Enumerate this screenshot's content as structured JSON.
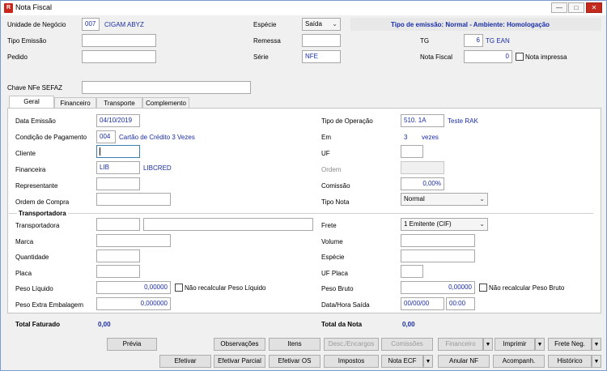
{
  "window": {
    "title": "Nota Fiscal",
    "icon_letter": "R",
    "icons": [
      "app-icon",
      "minimize-icon",
      "restore-icon",
      "close-icon"
    ],
    "controls": {
      "minimize": "—",
      "restore": "□",
      "close": "✕"
    }
  },
  "header": {
    "unidade_label": "Unidade de Negócio",
    "unidade_code": "007",
    "unidade_name": "CIGAM ABYZ",
    "especie_label": "Espécie",
    "especie_value": "Saída",
    "tipo_emissao_info": "Tipo de emissão: Normal - Ambiente: Homologação",
    "tipo_emissao_label": "Tipo Emissão",
    "tipo_emissao_value": "",
    "remessa_label": "Remessa",
    "remessa_value": "",
    "tg_label": "TG",
    "tg_value": "6",
    "tg_name": "TG EAN",
    "pedido_label": "Pedido",
    "pedido_value": "",
    "serie_label": "Série",
    "serie_value": "NFE",
    "nota_fiscal_label": "Nota Fiscal",
    "nota_fiscal_value": "0",
    "nota_impressa_label": "Nota impressa",
    "chave_label": "Chave NFe SEFAZ",
    "chave_value": ""
  },
  "tabs": [
    {
      "label": "Geral",
      "active": true
    },
    {
      "label": "Financeiro",
      "active": false
    },
    {
      "label": "Transporte",
      "active": false
    },
    {
      "label": "Complemento",
      "active": false
    }
  ],
  "geral": {
    "data_emissao_label": "Data Emissão",
    "data_emissao_value": "04/10/2019",
    "tipo_operacao_label": "Tipo de Operação",
    "tipo_operacao_code": "510. 1A",
    "tipo_operacao_name": "Teste RAK",
    "cond_pag_label": "Condição de Pagamento",
    "cond_pag_code": "004",
    "cond_pag_name": "Cartão de Crédito 3 Vezes",
    "em_label": "Em",
    "em_value": "3",
    "em_unit": "vezes",
    "cliente_label": "Cliente",
    "cliente_value": "",
    "uf_label": "UF",
    "uf_value": "",
    "financeira_label": "Financeira",
    "financeira_code": "LIB",
    "financeira_name": "LIBCRED",
    "ordem_label": "Ordem",
    "ordem_value": "",
    "representante_label": "Representante",
    "representante_value": "",
    "comissao_label": "Comissão",
    "comissao_value": "0,00%",
    "ordem_compra_label": "Ordem de Compra",
    "ordem_compra_value": "",
    "tipo_nota_label": "Tipo Nota",
    "tipo_nota_value": "Normal"
  },
  "transportadora": {
    "group_label": "Transportadora",
    "transportadora_label": "Transportadora",
    "transportadora_code": "",
    "transportadora_name": "",
    "frete_label": "Frete",
    "frete_value": "1 Emitente (CIF)",
    "marca_label": "Marca",
    "marca_value": "",
    "volume_label": "Volume",
    "volume_value": "",
    "quantidade_label": "Quantidade",
    "quantidade_value": "",
    "especie_label": "Espécie",
    "especie_value": "",
    "placa_label": "Placa",
    "placa_value": "",
    "uf_placa_label": "UF Placa",
    "uf_placa_value": "",
    "peso_liquido_label": "Peso Líquido",
    "peso_liquido_value": "0,00000",
    "nao_recalc_liq_label": "Não recalcular Peso Líquido",
    "peso_bruto_label": "Peso Bruto",
    "peso_bruto_value": "0,00000",
    "nao_recalc_bruto_label": "Não recalcular Peso Bruto",
    "peso_extra_label": "Peso Extra Embalagem",
    "peso_extra_value": "0,000000",
    "data_hora_saida_label": "Data/Hora Saída",
    "data_saida_value": "00/00/00",
    "hora_saida_value": "00:00"
  },
  "totals": {
    "total_faturado_label": "Total Faturado",
    "total_faturado_value": "0,00",
    "total_nota_label": "Total da Nota",
    "total_nota_value": "0,00"
  },
  "buttons": {
    "previa": "Prévia",
    "observacoes": "Observações",
    "itens": "Itens",
    "desc_encargos": "Desc./Encargos",
    "comissoes": "Comissões",
    "financeiro": "Financeiro",
    "imprimir": "Imprimir",
    "frete_neg": "Frete Neg.",
    "efetivar": "Efetivar",
    "efetivar_parcial": "Efetivar Parcial",
    "efetivar_os": "Efetivar OS",
    "impostos": "Impostos",
    "nota_ecf": "Nota ECF",
    "anular_nf": "Anular NF",
    "acompanh": "Acompanh.",
    "historico": "Histórico",
    "dropdown_arrow": "▼"
  }
}
